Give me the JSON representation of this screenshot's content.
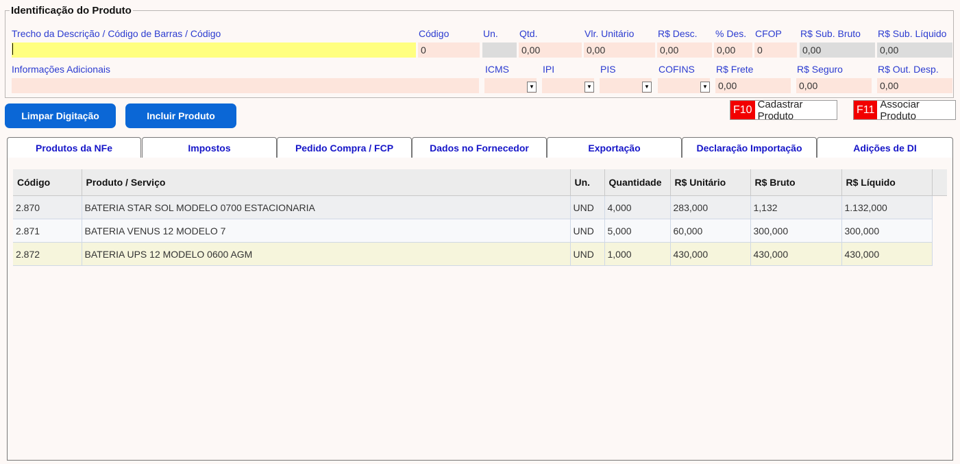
{
  "section": {
    "title": "Identificação do Produto"
  },
  "fields": {
    "descricao": {
      "label": "Trecho da Descrição / Código de Barras / Código",
      "value": ""
    },
    "codigo": {
      "label": "Código",
      "value": "0"
    },
    "un": {
      "label": "Un.",
      "value": ""
    },
    "qtd": {
      "label": "Qtd.",
      "value": "0,00"
    },
    "vlr_unitario": {
      "label": "Vlr. Unitário",
      "value": "0,00"
    },
    "desc": {
      "label": "R$ Desc.",
      "value": "0,00"
    },
    "pct_des": {
      "label": "% Des.",
      "value": "0,00"
    },
    "cfop": {
      "label": "CFOP",
      "value": "0"
    },
    "sub_bruto": {
      "label": "R$ Sub. Bruto",
      "value": "0,00"
    },
    "sub_liquido": {
      "label": "R$ Sub. Líquido",
      "value": "0,00"
    },
    "info_adicionais": {
      "label": "Informações Adicionais",
      "value": ""
    },
    "icms": {
      "label": "ICMS"
    },
    "ipi": {
      "label": "IPI"
    },
    "pis": {
      "label": "PIS"
    },
    "cofins": {
      "label": "COFINS"
    },
    "frete": {
      "label": "R$ Frete",
      "value": "0,00"
    },
    "seguro": {
      "label": "R$ Seguro",
      "value": "0,00"
    },
    "out_desp": {
      "label": "R$ Out. Desp.",
      "value": "0,00"
    }
  },
  "buttons": {
    "limpar": "Limpar Digitação",
    "incluir": "Incluir Produto",
    "cadastrar_key": "F10",
    "cadastrar": "Cadastrar Produto",
    "associar_key": "F11",
    "associar": "Associar Produto"
  },
  "tabs": [
    {
      "label": "Produtos da NFe",
      "active": true
    },
    {
      "label": "Impostos"
    },
    {
      "label": "Pedido Compra / FCP"
    },
    {
      "label": "Dados no Fornecedor"
    },
    {
      "label": "Exportação"
    },
    {
      "label": "Declaração Importação"
    },
    {
      "label": "Adições de DI"
    }
  ],
  "table": {
    "headers": [
      "Código",
      "Produto / Serviço",
      "Un.",
      "Quantidade",
      "R$ Unitário",
      "R$ Bruto",
      "R$ Líquido"
    ],
    "rows": [
      [
        "2.870",
        "BATERIA STAR SOL MODELO 0700 ESTACIONARIA",
        "UND",
        "4,000",
        "283,000",
        "1,132",
        "1.132,000"
      ],
      [
        "2.871",
        "BATERIA VENUS 12 MODELO 7",
        "UND",
        "5,000",
        "60,000",
        "300,000",
        "300,000"
      ],
      [
        "2.872",
        "BATERIA UPS 12 MODELO 0600 AGM",
        "UND",
        "1,000",
        "430,000",
        "430,000",
        "430,000"
      ]
    ]
  },
  "colors": {
    "accent": "#0b67d6",
    "label": "#2b3bd0",
    "fkey": "#f20000",
    "input": "#fde5dc",
    "active_input": "#ffff80"
  }
}
